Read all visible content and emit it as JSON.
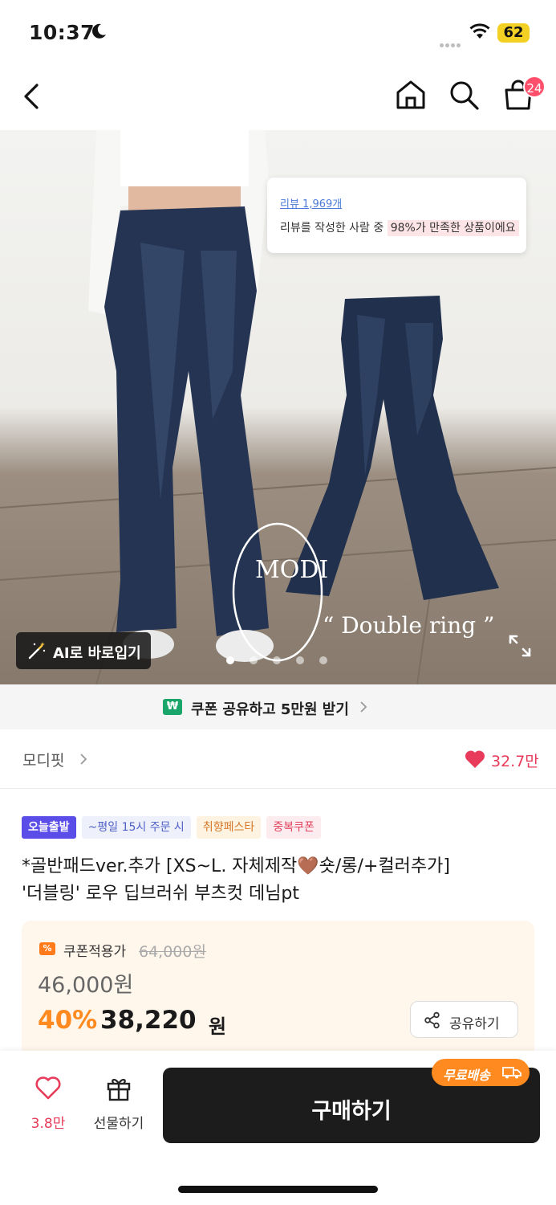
{
  "status_bar": {
    "time": "10:37",
    "battery": "62"
  },
  "nav": {
    "cart_count": "24"
  },
  "hero": {
    "review_count": "리뷰 1,969개",
    "review_text_prefix": "리뷰를 작성한 사람 중",
    "review_highlight": "98%가 만족한 상품이에요",
    "ai_button_label": "AI로 바로입기",
    "watermark_letters": "MODI",
    "watermark_caption": "“ Double ring ”",
    "page_dots": 5,
    "active_dot": 1
  },
  "coupon_banner": {
    "icon_text": "₩",
    "text": "쿠폰 공유하고 5만원 받기"
  },
  "shop": {
    "name": "모디핏",
    "likes": "32.7만"
  },
  "badges": [
    "오늘출발",
    "~평일 15시 주문 시",
    "취향페스타",
    "중복쿠폰"
  ],
  "product": {
    "title_line1": "*골반패드ver.추가 [XS~L. 자체제작🤎숏/롱/+컬러추가]",
    "title_line2": "'더블링' 로우 딥브러쉬 부츠컷 데님pt"
  },
  "price": {
    "coupon_label": "쿠폰적용가",
    "original_price": "64,000원",
    "sale_price": "46,000원",
    "discount_rate": "40%",
    "final_price": "38,220",
    "currency": "원",
    "share_label": "공유하기"
  },
  "bottom_bar": {
    "favorite_count": "3.8만",
    "gift_label": "선물하기",
    "buy_label": "구매하기",
    "free_shipping_label": "무료배송"
  },
  "colors": {
    "accent_orange": "#ff8a1f",
    "like_red": "#e83a5a",
    "badge_purple": "#5b4de8",
    "buy_button": "#1c1c1c"
  }
}
